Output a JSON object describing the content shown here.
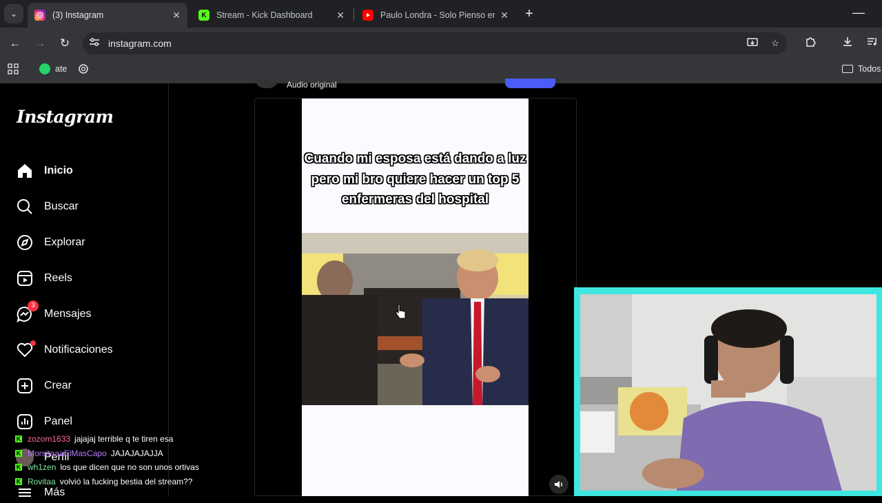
{
  "browser": {
    "tabs": [
      {
        "title": "(3) Instagram",
        "active": true,
        "icon": "instagram-icon"
      },
      {
        "title": "Stream - Kick Dashboard",
        "active": false,
        "icon": "kick-icon"
      },
      {
        "title": "Paulo Londra - Solo Pienso en Ti",
        "active": false,
        "icon": "youtube-icon"
      }
    ],
    "url": "instagram.com",
    "bookmarks": {
      "whatsapp_label": "ate",
      "all_bookmarks_label": "Todos"
    }
  },
  "instagram": {
    "logo": "Instagram",
    "nav": [
      {
        "label": "Inicio",
        "icon": "home-icon"
      },
      {
        "label": "Buscar",
        "icon": "search-icon"
      },
      {
        "label": "Explorar",
        "icon": "explore-icon"
      },
      {
        "label": "Reels",
        "icon": "reels-icon"
      },
      {
        "label": "Mensajes",
        "icon": "messages-icon"
      },
      {
        "label": "Notificaciones",
        "icon": "heart-icon"
      },
      {
        "label": "Crear",
        "icon": "create-icon"
      },
      {
        "label": "Panel",
        "icon": "dashboard-icon"
      },
      {
        "label": "Perfil",
        "icon": "avatar"
      },
      {
        "label": "Más",
        "icon": "menu-icon"
      }
    ],
    "messages_badge": "3",
    "post": {
      "audio": "Audio original",
      "caption": "Cuando mi esposa está dando a luz pero mi bro quiere hacer un top 5 enfermeras del hospital"
    }
  },
  "stream_chat": [
    {
      "user": "zozom1633",
      "color": "#ff6b9d",
      "message": "jajajaj terrible q te tiren esa"
    },
    {
      "user": "MorsitaaaElMasCapo",
      "color": "#b57aff",
      "message": "JAJAJAJAJJA"
    },
    {
      "user": "wh1zen",
      "color": "#7ee8a2",
      "message": "los que dicen que no son unos ortivas"
    },
    {
      "user": "Rovitaa",
      "color": "#7ee8a2",
      "message": "volvió la fucking bestia del stream??"
    }
  ],
  "colors": {
    "kick_green": "#53fc18",
    "instagram_badge": "#ff3040",
    "webcam_border": "#3ee7e0",
    "follow_button": "#4a5df9"
  }
}
